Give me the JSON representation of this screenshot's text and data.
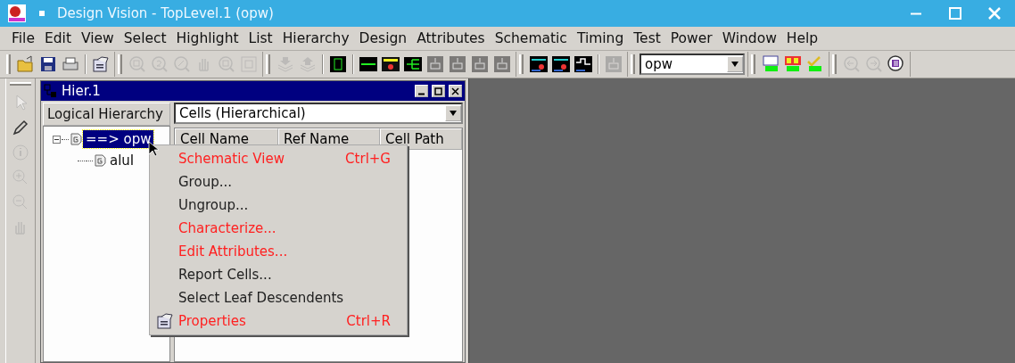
{
  "window": {
    "title": "Design Vision - TopLevel.1 (opw)"
  },
  "menu_bar": [
    {
      "label": "File"
    },
    {
      "label": "Edit"
    },
    {
      "label": "View"
    },
    {
      "label": "Select"
    },
    {
      "label": "Highlight"
    },
    {
      "label": "List"
    },
    {
      "label": "Hierarchy"
    },
    {
      "label": "Design"
    },
    {
      "label": "Attributes"
    },
    {
      "label": "Schematic"
    },
    {
      "label": "Timing"
    },
    {
      "label": "Test"
    },
    {
      "label": "Power"
    },
    {
      "label": "Window"
    },
    {
      "label": "Help"
    }
  ],
  "toolbar": [
    [
      {
        "kind": "open",
        "disabled": false
      },
      {
        "kind": "save",
        "disabled": false
      },
      {
        "kind": "print",
        "disabled": false
      },
      {
        "kind": "separator"
      },
      {
        "kind": "properties",
        "disabled": false
      }
    ],
    [
      {
        "kind": "zoom-fit",
        "disabled": true
      },
      {
        "kind": "zoom-2",
        "disabled": true
      },
      {
        "kind": "zoom-half",
        "disabled": true
      },
      {
        "kind": "pan",
        "disabled": true
      },
      {
        "kind": "zoom-box",
        "disabled": true
      },
      {
        "kind": "zoom-full",
        "disabled": true
      }
    ],
    [
      {
        "kind": "push",
        "disabled": true
      },
      {
        "kind": "pop",
        "disabled": true
      },
      {
        "kind": "separator"
      },
      {
        "kind": "chip",
        "disabled": false
      },
      {
        "kind": "separator"
      },
      {
        "kind": "path",
        "disabled": false
      },
      {
        "kind": "cone",
        "disabled": false
      },
      {
        "kind": "tree",
        "disabled": false
      },
      {
        "kind": "block",
        "disabled": false
      },
      {
        "kind": "block",
        "disabled": false
      },
      {
        "kind": "block",
        "disabled": false
      },
      {
        "kind": "block",
        "disabled": false
      }
    ],
    [
      {
        "kind": "timing-path",
        "disabled": false
      },
      {
        "kind": "timing-path",
        "disabled": false
      },
      {
        "kind": "timing-graph",
        "disabled": false
      },
      {
        "kind": "separator"
      },
      {
        "kind": "block",
        "disabled": true
      }
    ],
    [
      {
        "kind": "combo",
        "value": "opw"
      }
    ],
    [
      {
        "kind": "viewer",
        "disabled": false
      },
      {
        "kind": "design",
        "disabled": false
      },
      {
        "kind": "check",
        "disabled": false
      }
    ],
    [
      {
        "kind": "back",
        "disabled": true
      },
      {
        "kind": "forward",
        "disabled": true
      },
      {
        "kind": "list",
        "disabled": false
      }
    ]
  ],
  "side_toolbar": [
    {
      "kind": "pointer",
      "disabled": true
    },
    {
      "kind": "pencil",
      "disabled": false
    },
    {
      "kind": "info",
      "disabled": true
    },
    {
      "kind": "zoom-in",
      "disabled": true
    },
    {
      "kind": "zoom-out",
      "disabled": true
    },
    {
      "kind": "hand",
      "disabled": true
    }
  ],
  "hier_window": {
    "title": "Hier.1",
    "view_button": "Logical Hierarchy",
    "filter": "Cells (Hierarchical)",
    "tree": [
      {
        "label": "==> opw",
        "selected": true,
        "expanded": true,
        "children": [
          {
            "label": "aluI",
            "selected": false
          }
        ]
      }
    ],
    "columns": [
      "Cell Name",
      "Ref Name",
      "Cell Path"
    ]
  },
  "context_menu": [
    {
      "label": "Schematic View",
      "shortcut": "Ctrl+G",
      "color": "#ff2020"
    },
    {
      "label": "Group...",
      "color": "#202020"
    },
    {
      "label": "Ungroup...",
      "color": "#202020"
    },
    {
      "label": "Characterize...",
      "color": "#ff2020"
    },
    {
      "label": "Edit Attributes...",
      "color": "#ff2020"
    },
    {
      "label": "Report Cells...",
      "color": "#202020"
    },
    {
      "label": "Select Leaf Descendents",
      "color": "#202020"
    },
    {
      "label": "Properties",
      "shortcut": "Ctrl+R",
      "color": "#ff2020",
      "icon": true
    }
  ]
}
